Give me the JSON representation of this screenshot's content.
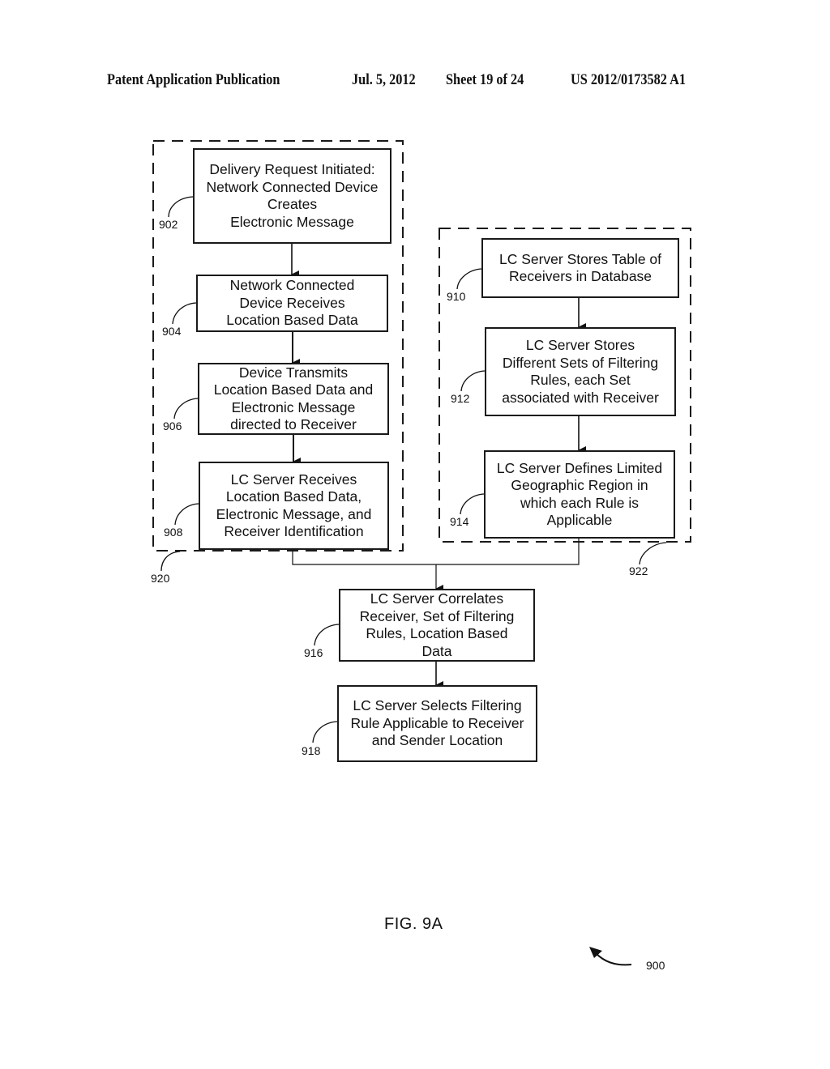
{
  "header": {
    "left": "Patent Application Publication",
    "date": "Jul. 5, 2012",
    "sheet": "Sheet 19 of 24",
    "number": "US 2012/0173582 A1"
  },
  "figure": {
    "label": "FIG. 9A",
    "ref": "900"
  },
  "groups": [
    {
      "id": "920",
      "ref": "920"
    },
    {
      "id": "922",
      "ref": "922"
    }
  ],
  "steps": [
    {
      "id": "902",
      "ref": "902",
      "text": "Delivery Request Initiated:\nNetwork Connected Device\nCreates\nElectronic Message"
    },
    {
      "id": "904",
      "ref": "904",
      "text": "Network Connected\nDevice Receives\nLocation Based Data"
    },
    {
      "id": "906",
      "ref": "906",
      "text": "Device Transmits\nLocation Based Data and\nElectronic Message\ndirected to Receiver"
    },
    {
      "id": "908",
      "ref": "908",
      "text": "LC Server Receives\nLocation Based Data,\nElectronic Message, and\nReceiver Identification"
    },
    {
      "id": "910",
      "ref": "910",
      "text": "LC Server Stores Table of\nReceivers in Database"
    },
    {
      "id": "912",
      "ref": "912",
      "text": "LC Server Stores\nDifferent Sets of Filtering\nRules, each Set\nassociated with Receiver"
    },
    {
      "id": "914",
      "ref": "914",
      "text": "LC Server Defines Limited\nGeographic Region in\nwhich each Rule is\nApplicable"
    },
    {
      "id": "916",
      "ref": "916",
      "text": "LC Server Correlates\nReceiver, Set of Filtering\nRules, Location Based\nData"
    },
    {
      "id": "918",
      "ref": "918",
      "text": "LC Server Selects Filtering\nRule Applicable to Receiver\nand Sender Location"
    }
  ]
}
